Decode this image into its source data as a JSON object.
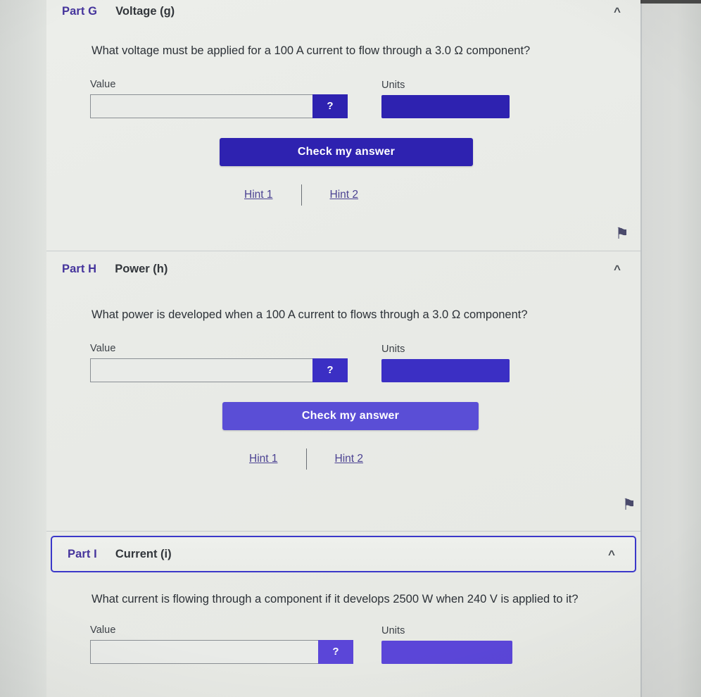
{
  "page": {
    "background_color": "#e9ebe7",
    "accent_deep": "#2e22b0",
    "accent_violet": "#5a4ed6",
    "part_id_color": "#45349c",
    "link_color": "#4b4292"
  },
  "common": {
    "value_label": "Value",
    "units_label": "Units",
    "value_placeholder": "",
    "value_text": "",
    "units_text": "",
    "hint_button_glyph": "?",
    "check_label": "Check my answer",
    "hint1_label": "Hint 1",
    "hint2_label": "Hint 2",
    "collapse_glyph": "^",
    "flag_glyph": "⚑"
  },
  "sections": [
    {
      "id": "part-g",
      "part_id": "Part G",
      "title": "Voltage (g)",
      "prompt": "What voltage must be applied for a 100 A current to flow through a 3.0 Ω component?",
      "accent": "#2e22b0",
      "active": false,
      "collapsed_glyph": "^"
    },
    {
      "id": "part-h",
      "part_id": "Part H",
      "title": "Power (h)",
      "prompt": "What power is developed when a 100 A current to flows through a 3.0 Ω component?",
      "accent": "#5a4ed6",
      "active": false,
      "collapsed_glyph": "^"
    },
    {
      "id": "part-i",
      "part_id": "Part I",
      "title": "Current (i)",
      "prompt": "What current is flowing through a component if it develops 2500 W when 240 V is applied to it?",
      "accent": "#5a4ed6",
      "active": true,
      "collapsed_glyph": "^"
    }
  ]
}
